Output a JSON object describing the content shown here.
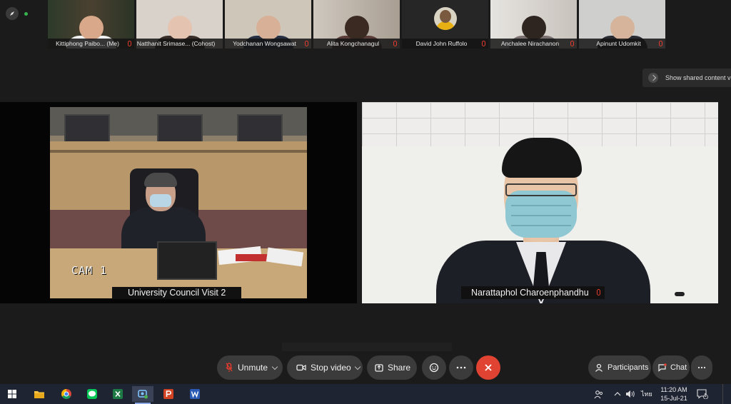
{
  "participants": [
    {
      "name": "Kittiphong Paibo... (Me)",
      "bg": "#3a3a2c"
    },
    {
      "name": "Natthanit Srimase... (Cohost)",
      "bg": "#d8d2cb"
    },
    {
      "name": "Yodchanan Wongsawat",
      "bg": "#cfc6ba"
    },
    {
      "name": "Alita Kongchanagul",
      "bg": "#b8b0a6"
    },
    {
      "name": "David John Ruffolo",
      "bg": "#262626"
    },
    {
      "name": "Anchalee Nirachanon",
      "bg": "#d9d6d2"
    },
    {
      "name": "Apinunt Udomkit",
      "bg": "#cfcfcd"
    }
  ],
  "shared_content_note": "Show shared content vi",
  "left_video": {
    "cam_label": "CAM 1",
    "name": "University Council Visit 2"
  },
  "right_video": {
    "name": "Narattaphol Charoenphandhu"
  },
  "controls": {
    "unmute": "Unmute",
    "stop_video": "Stop video",
    "share": "Share",
    "participants": "Participants",
    "chat": "Chat"
  },
  "colors": {
    "end_call": "#e04332",
    "muted_mic": "#e03b2e",
    "taskbar": "#1f2433"
  },
  "taskbar": {
    "icons": [
      "windows-start-icon",
      "file-explorer-icon",
      "chrome-icon",
      "line-app-icon",
      "excel-icon",
      "webex-icon",
      "powerpoint-icon",
      "word-icon"
    ],
    "language": "ไทย",
    "time": "11:20 AM",
    "date": "15-Jul-21",
    "notification_count": "1"
  }
}
